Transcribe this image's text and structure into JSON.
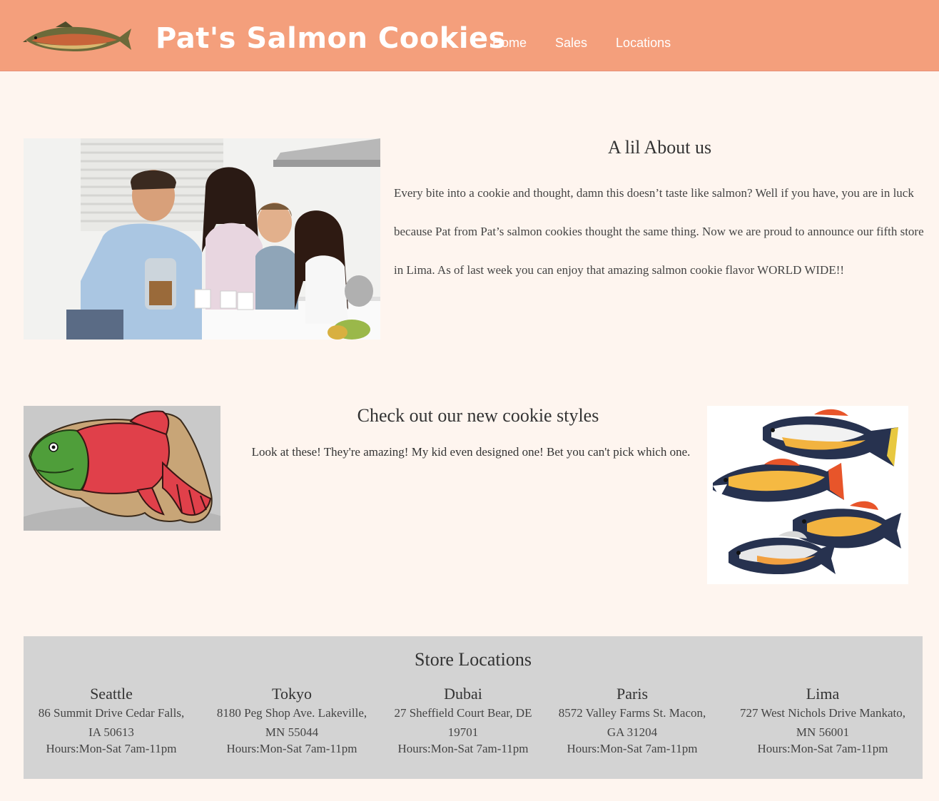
{
  "header": {
    "title": "Pat's Salmon Cookies",
    "logo_icon": "salmon-fish-icon",
    "nav": [
      {
        "label": "Home"
      },
      {
        "label": "Sales"
      },
      {
        "label": "Locations"
      }
    ]
  },
  "about": {
    "heading": "A lil About us",
    "body": "Every bite into a cookie and thought, damn this doesn’t taste like salmon? Well if you have, you are in luck because Pat from Pat’s salmon cookies thought the same thing. Now we are proud to announce our fifth store in Lima. As of last week you can enjoy that amazing salmon cookie flavor WORLD WIDE!!"
  },
  "cookies": {
    "heading": "Check out our new cookie styles",
    "body": "Look at these! They're amazing! My kid even designed one! Bet you can't pick which one."
  },
  "stores": {
    "heading": "Store Locations",
    "items": [
      {
        "city": "Seattle",
        "address": "86 Summit Drive Cedar Falls, IA 50613",
        "hours": "Hours:Mon-Sat 7am-11pm"
      },
      {
        "city": "Tokyo",
        "address": "8180 Peg Shop Ave. Lakeville, MN 55044",
        "hours": "Hours:Mon-Sat 7am-11pm"
      },
      {
        "city": "Dubai",
        "address": "27 Sheffield Court Bear, DE 19701",
        "hours": "Hours:Mon-Sat 7am-11pm"
      },
      {
        "city": "Paris",
        "address": "8572 Valley Farms St. Macon, GA 31204",
        "hours": "Hours:Mon-Sat 7am-11pm"
      },
      {
        "city": "Lima",
        "address": "727 West Nichols Drive Mankato, MN 56001",
        "hours": "Hours:Mon-Sat 7am-11pm"
      }
    ]
  },
  "colors": {
    "header_bg": "#f49f7c",
    "page_bg": "#fef5ef",
    "stores_bg": "#d3d3d3"
  }
}
